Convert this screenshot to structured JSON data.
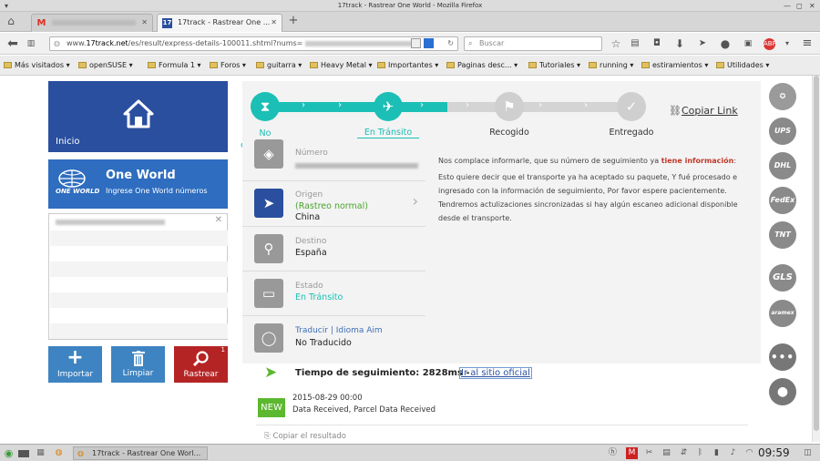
{
  "window": {
    "title": "17track - Rastrear One World - Mozilla Firefox"
  },
  "tabs": [
    {
      "label": "Gmail",
      "icon": "gmail-icon"
    },
    {
      "label": "17track - Rastrear One ...",
      "icon": "17track-icon",
      "favicon_text": "17"
    }
  ],
  "nav": {
    "url_prefix": "www.",
    "url_domain": "17track.net",
    "url_path": "/es/result/express-details-100011.shtml?nums=",
    "search_placeholder": "Buscar"
  },
  "bookmarks": [
    {
      "label": "Más visitados",
      "icon": "gear-icon"
    },
    {
      "label": "openSUSE",
      "icon": "folder-icon"
    },
    {
      "label": "Formula 1",
      "icon": "folder-icon"
    },
    {
      "label": "Foros",
      "icon": "folder-icon"
    },
    {
      "label": "guitarra",
      "icon": "folder-icon"
    },
    {
      "label": "Heavy Metal",
      "icon": "folder-icon"
    },
    {
      "label": "Importantes",
      "icon": "folder-icon"
    },
    {
      "label": "Paginas desc...",
      "icon": "folder-icon"
    },
    {
      "label": "Tutoriales",
      "icon": "folder-icon"
    },
    {
      "label": "running",
      "icon": "folder-icon"
    },
    {
      "label": "estiramientos",
      "icon": "folder-icon"
    },
    {
      "label": "Utilidades",
      "icon": "folder-icon"
    }
  ],
  "sidebar": {
    "home_label": "Inicio",
    "carrier_name": "One World",
    "carrier_sub": "Ingrese One World números",
    "carrier_logo_text": "ONE WORLD",
    "buttons": {
      "import": "Importar",
      "clear": "Limpiar",
      "track": "Rastrear",
      "track_badge": "1"
    }
  },
  "steps": [
    {
      "label": "No encontrado",
      "state": "done",
      "icon": "hourglass-icon"
    },
    {
      "label": "En Tránsito",
      "state": "current",
      "icon": "plane-icon"
    },
    {
      "label": "Recogido",
      "state": "pending",
      "icon": "flag-icon"
    },
    {
      "label": "Entregado",
      "state": "pending",
      "icon": "check-icon"
    }
  ],
  "copy_link": "Copiar Link",
  "info": {
    "number_label": "Número",
    "origin_label": "Origen",
    "origin_note": "(Rastreo normal)",
    "origin_value": "China",
    "dest_label": "Destino",
    "dest_value": "España",
    "state_label": "Estado",
    "state_value": "En Tránsito",
    "translate_link": "Traducir",
    "lang_link": "Idioma Aim",
    "translate_value": "No Traducido"
  },
  "message": {
    "intro": "Nos complace informarle, que su número de seguimiento ya",
    "highlight": "tiene información",
    "colon": ":",
    "body": "Esto quiere decir que el transporte ya ha aceptado su paquete, Y fué procesado e ingresado con la información de seguimiento, Por favor espere pacientemente. Tendremos actulizaciones sincronizadas si hay algún escaneo adicional disponible desde el transporte."
  },
  "tracking": {
    "time_label": "Tiempo de seguimiento: 2828ms -",
    "official_link": "Ir al sitio oficial",
    "badge": "NEW",
    "event_date": "2015-08-29 00:00",
    "event_desc": "Data Received, Parcel Data Received",
    "copy_result": "Copiar el resultado"
  },
  "carriers": [
    "UPS",
    "DHL",
    "FedEx",
    "TNT",
    "GLS",
    "aramex"
  ],
  "taskbar": {
    "window_label": "17track - Rastrear One Worl...",
    "clock": "09:59"
  },
  "colors": {
    "teal": "#1bbfb5",
    "navy": "#2a4f9e",
    "blue": "#2e6dbf",
    "red": "#b52424",
    "green": "#5cb82f",
    "highlight_red": "#c0392b"
  }
}
